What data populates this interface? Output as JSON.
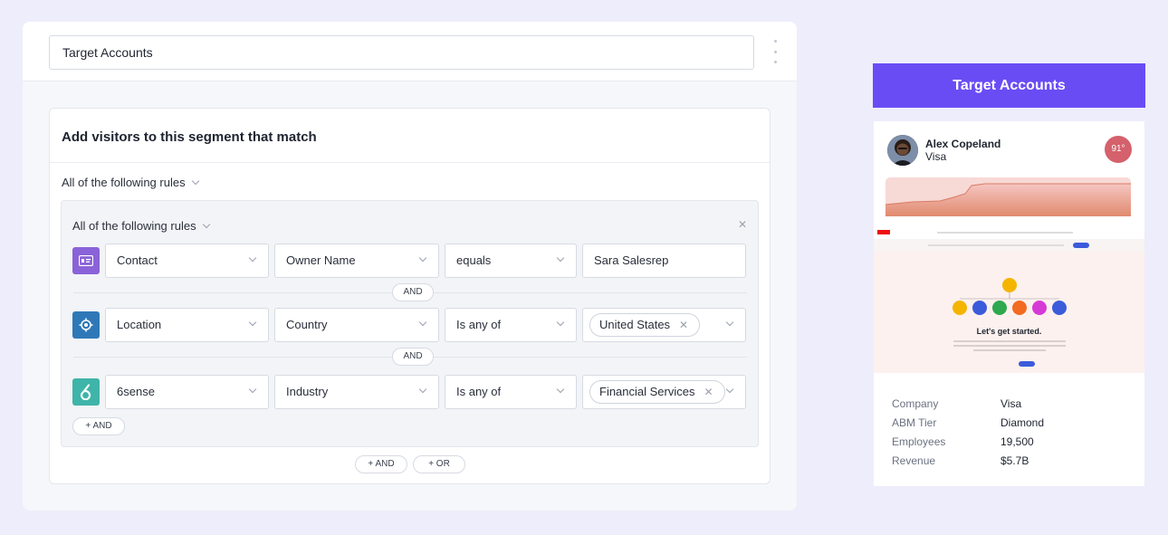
{
  "segment": {
    "name": "Target Accounts"
  },
  "rules": {
    "title": "Add visitors to this segment that match",
    "outer_match": "All of the following rules",
    "group_match": "All of the following rules",
    "rows": [
      {
        "icon": "contact-card-icon",
        "icon_color": "#8a63d8",
        "source": "Contact",
        "field": "Owner Name",
        "operator": "equals",
        "value": "Sara Salesrep",
        "value_type": "text"
      },
      {
        "icon": "location-target-icon",
        "icon_color": "#2f78b7",
        "source": "Location",
        "field": "Country",
        "operator": "Is any of",
        "value": "United States",
        "value_type": "chip"
      },
      {
        "icon": "6sense-logo-icon",
        "icon_color": "#3fb4a8",
        "source": "6sense",
        "field": "Industry",
        "operator": "Is any of",
        "value": "Financial Services",
        "value_type": "chip"
      }
    ],
    "and_separator": "AND",
    "group_add_and": "+ AND",
    "add_and": "+ AND",
    "add_or": "+ OR"
  },
  "preview": {
    "button_label": "Target Accounts",
    "person_name": "Alex Copeland",
    "company": "Visa",
    "score": "91°",
    "site_heading": "Let's get started.",
    "details": [
      {
        "label": "Company",
        "value": "Visa"
      },
      {
        "label": "ABM Tier",
        "value": "Diamond"
      },
      {
        "label": "Employees",
        "value": "19,500"
      },
      {
        "label": "Revenue",
        "value": "$5.7B"
      }
    ]
  },
  "colors": {
    "accent": "#6a4cf5",
    "score": "#d4616b",
    "engagement": "#de7a5e"
  }
}
